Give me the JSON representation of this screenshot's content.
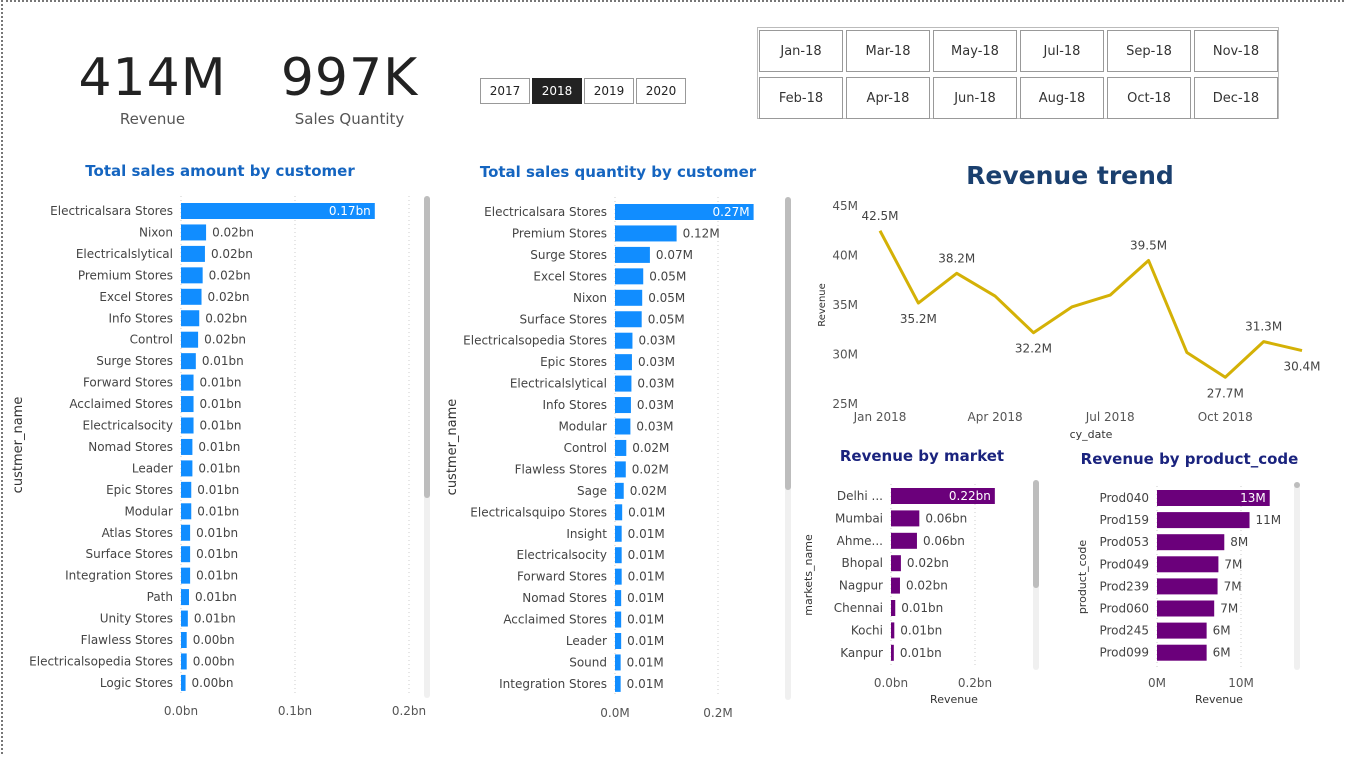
{
  "kpis": {
    "revenue": {
      "value": "414M",
      "label": "Revenue"
    },
    "quantity": {
      "value": "997K",
      "label": "Sales Quantity"
    }
  },
  "year_slicer": {
    "options": [
      "2017",
      "2018",
      "2019",
      "2020"
    ],
    "selected": "2018"
  },
  "month_slicer": {
    "options": [
      "Jan-18",
      "Mar-18",
      "May-18",
      "Jul-18",
      "Sep-18",
      "Nov-18",
      "Feb-18",
      "Apr-18",
      "Jun-18",
      "Aug-18",
      "Oct-18",
      "Dec-18"
    ]
  },
  "colors": {
    "blue_bar": "#118dff",
    "purple_bar": "#6b007b",
    "line": "#d4b106",
    "title_blue": "#1565c0",
    "title_navy": "#1a237e"
  },
  "chart_data": [
    {
      "id": "sales_amount",
      "type": "bar",
      "orientation": "horizontal",
      "title": "Total sales amount by customer",
      "ylabel": "custmer_name",
      "xlabel": "",
      "categories": [
        "Electricalsara Stores",
        "Nixon",
        "Electricalslytical",
        "Premium Stores",
        "Excel Stores",
        "Info Stores",
        "Control",
        "Surge Stores",
        "Forward Stores",
        "Acclaimed Stores",
        "Electricalsocity",
        "Nomad Stores",
        "Leader",
        "Epic Stores",
        "Modular",
        "Atlas Stores",
        "Surface Stores",
        "Integration Stores",
        "Path",
        "Unity Stores",
        "Flawless Stores",
        "Electricalsopedia Stores",
        "Logic Stores"
      ],
      "values": [
        0.17,
        0.022,
        0.021,
        0.019,
        0.018,
        0.016,
        0.015,
        0.013,
        0.011,
        0.011,
        0.011,
        0.01,
        0.01,
        0.009,
        0.009,
        0.008,
        0.008,
        0.008,
        0.007,
        0.006,
        0.005,
        0.005,
        0.004
      ],
      "data_labels": [
        "0.17bn",
        "0.02bn",
        "0.02bn",
        "0.02bn",
        "0.02bn",
        "0.02bn",
        "0.02bn",
        "0.01bn",
        "0.01bn",
        "0.01bn",
        "0.01bn",
        "0.01bn",
        "0.01bn",
        "0.01bn",
        "0.01bn",
        "0.01bn",
        "0.01bn",
        "0.01bn",
        "0.01bn",
        "0.01bn",
        "0.00bn",
        "0.00bn",
        "0.00bn"
      ],
      "xlim": [
        0,
        0.2
      ],
      "xticks": [
        "0.0bn",
        "0.1bn",
        "0.2bn"
      ],
      "unit": "bn"
    },
    {
      "id": "sales_quantity",
      "type": "bar",
      "orientation": "horizontal",
      "title": "Total sales quantity by customer",
      "ylabel": "custmer_name",
      "xlabel": "",
      "categories": [
        "Electricalsara Stores",
        "Premium Stores",
        "Surge Stores",
        "Excel Stores",
        "Nixon",
        "Surface Stores",
        "Electricalsopedia Stores",
        "Epic Stores",
        "Electricalslytical",
        "Info Stores",
        "Modular",
        "Control",
        "Flawless Stores",
        "Sage",
        "Electricalsquipo Stores",
        "Insight",
        "Electricalsocity",
        "Forward Stores",
        "Nomad Stores",
        "Acclaimed Stores",
        "Leader",
        "Sound",
        "Integration Stores"
      ],
      "values": [
        0.27,
        0.12,
        0.068,
        0.055,
        0.053,
        0.052,
        0.034,
        0.033,
        0.032,
        0.031,
        0.03,
        0.022,
        0.021,
        0.017,
        0.014,
        0.013,
        0.013,
        0.013,
        0.012,
        0.012,
        0.012,
        0.011,
        0.011
      ],
      "data_labels": [
        "0.27M",
        "0.12M",
        "0.07M",
        "0.05M",
        "0.05M",
        "0.05M",
        "0.03M",
        "0.03M",
        "0.03M",
        "0.03M",
        "0.03M",
        "0.02M",
        "0.02M",
        "0.02M",
        "0.01M",
        "0.01M",
        "0.01M",
        "0.01M",
        "0.01M",
        "0.01M",
        "0.01M",
        "0.01M",
        "0.01M"
      ],
      "xlim": [
        0,
        0.3
      ],
      "xticks": [
        "0.0M",
        "0.2M"
      ],
      "unit": "M"
    },
    {
      "id": "revenue_trend",
      "type": "line",
      "title": "Revenue trend",
      "xlabel": "cy_date",
      "ylabel": "Revenue",
      "x": [
        "2018-01",
        "2018-02",
        "2018-03",
        "2018-04",
        "2018-05",
        "2018-06",
        "2018-07",
        "2018-08",
        "2018-09",
        "2018-10",
        "2018-11",
        "2018-12"
      ],
      "values": [
        42.5,
        35.2,
        38.2,
        35.9,
        32.2,
        34.8,
        36.0,
        39.5,
        30.2,
        27.7,
        31.3,
        30.4
      ],
      "point_labels": [
        "42.5M",
        "35.2M",
        "38.2M",
        "",
        "32.2M",
        "",
        "",
        "39.5M",
        "",
        "27.7M",
        "31.3M",
        "30.4M"
      ],
      "ylim": [
        25,
        45
      ],
      "yticks": [
        "25M",
        "30M",
        "35M",
        "40M",
        "45M"
      ],
      "xticks": [
        "Jan 2018",
        "Apr 2018",
        "Jul 2018",
        "Oct 2018"
      ]
    },
    {
      "id": "revenue_by_market",
      "type": "bar",
      "orientation": "horizontal",
      "title": "Revenue by market",
      "ylabel": "markets_name",
      "xlabel": "Revenue",
      "categories": [
        "Delhi ...",
        "Mumbai",
        "Ahme...",
        "Bhopal",
        "Nagpur",
        "Chennai",
        "Kochi",
        "Kanpur"
      ],
      "values": [
        0.22,
        0.06,
        0.055,
        0.021,
        0.019,
        0.009,
        0.007,
        0.006
      ],
      "data_labels": [
        "0.22bn",
        "0.06bn",
        "0.06bn",
        "0.02bn",
        "0.02bn",
        "0.01bn",
        "0.01bn",
        "0.01bn"
      ],
      "xlim": [
        0,
        0.25
      ],
      "xticks": [
        "0.0bn",
        "0.2bn"
      ]
    },
    {
      "id": "revenue_by_product",
      "type": "bar",
      "orientation": "horizontal",
      "title": "Revenue by product_code",
      "ylabel": "product_code",
      "xlabel": "Revenue",
      "categories": [
        "Prod040",
        "Prod159",
        "Prod053",
        "Prod049",
        "Prod239",
        "Prod060",
        "Prod245",
        "Prod099"
      ],
      "values": [
        13.4,
        11.0,
        8.0,
        7.3,
        7.2,
        6.8,
        5.9,
        5.9
      ],
      "data_labels": [
        "13M",
        "11M",
        "8M",
        "7M",
        "7M",
        "7M",
        "6M",
        "6M"
      ],
      "xlim": [
        0,
        17
      ],
      "xticks": [
        "0M",
        "10M"
      ]
    }
  ]
}
